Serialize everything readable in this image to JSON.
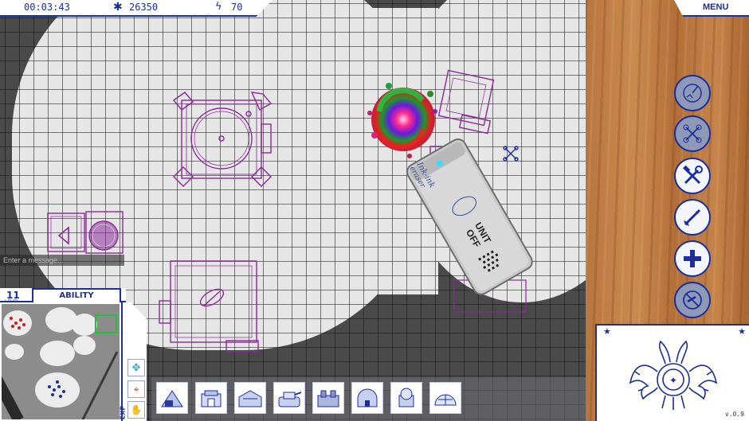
{
  "hud": {
    "timer": "00:03:43",
    "score": "26350",
    "energy": "70",
    "score_icon": "splat-icon",
    "energy_icon": "lightning-icon",
    "menu_label": "MENU"
  },
  "tools": [
    {
      "name": "tool-radar",
      "icon": "radar-icon",
      "state": "disabled"
    },
    {
      "name": "tool-drone",
      "icon": "drone-icon",
      "state": "disabled"
    },
    {
      "name": "tool-repair",
      "icon": "wrench-hammer-icon",
      "state": "enabled"
    },
    {
      "name": "tool-missile",
      "icon": "missile-icon",
      "state": "enabled"
    },
    {
      "name": "tool-heal",
      "icon": "plus-icon",
      "state": "enabled"
    },
    {
      "name": "tool-airstrike",
      "icon": "no-plane-icon",
      "state": "disabled"
    }
  ],
  "eraser": {
    "brand_top": "Ink-ink",
    "brand_sub": "eraser",
    "unit_label": "UNIT OFF"
  },
  "chat": {
    "placeholder": "Enter a message..."
  },
  "player": {
    "level": "11",
    "level_label": "LEVEL",
    "ability_label": "ABILITY",
    "exp_label": "EXP"
  },
  "build_menu": [
    "tent-unit",
    "bunker-unit",
    "barracks-unit",
    "tank-unit",
    "factory-unit",
    "dome-unit",
    "tower-unit",
    "radar-dome-unit"
  ],
  "version": "v.0.9",
  "colors": {
    "ink": "#1c2f9a",
    "sketch": "#8a2a9a",
    "paper": "#e6e6e6",
    "fog": "#4a4a4a"
  }
}
